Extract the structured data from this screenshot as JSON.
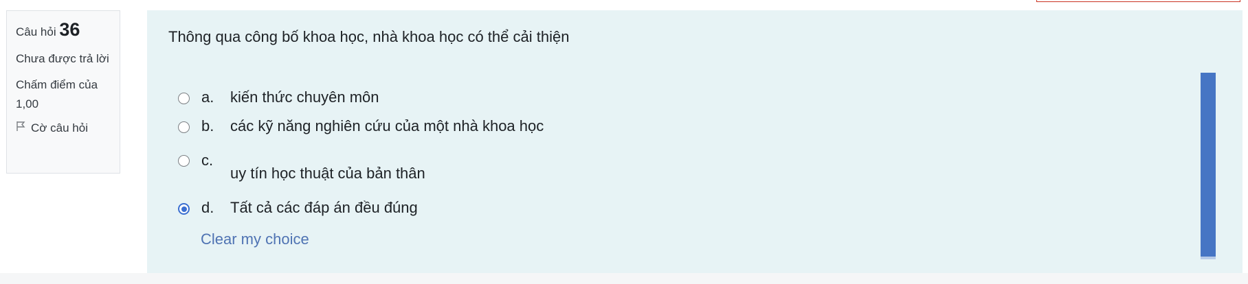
{
  "question_info": {
    "label": "Câu hỏi",
    "number": "36",
    "state": "Chưa được trả lời",
    "grade": "Chấm điểm của 1,00",
    "flag": "Cờ câu hỏi"
  },
  "question": {
    "text": "Thông qua công bố khoa học, nhà khoa học có thể cải thiện",
    "answers": [
      {
        "letter": "a.",
        "text": "kiến thức chuyên môn",
        "selected": false
      },
      {
        "letter": "b.",
        "text": "các kỹ năng nghiên cứu của một nhà khoa học",
        "selected": false
      },
      {
        "letter": "c.",
        "text": "uy tín học thuật của bản thân",
        "selected": false
      },
      {
        "letter": "d.",
        "text": "Tất cả các đáp án đều đúng",
        "selected": true
      }
    ],
    "clear_choice": "Clear my choice"
  },
  "colors": {
    "panel_bg": "#e7f3f5",
    "accent": "#3b6fd1",
    "link": "#4f73b3"
  }
}
